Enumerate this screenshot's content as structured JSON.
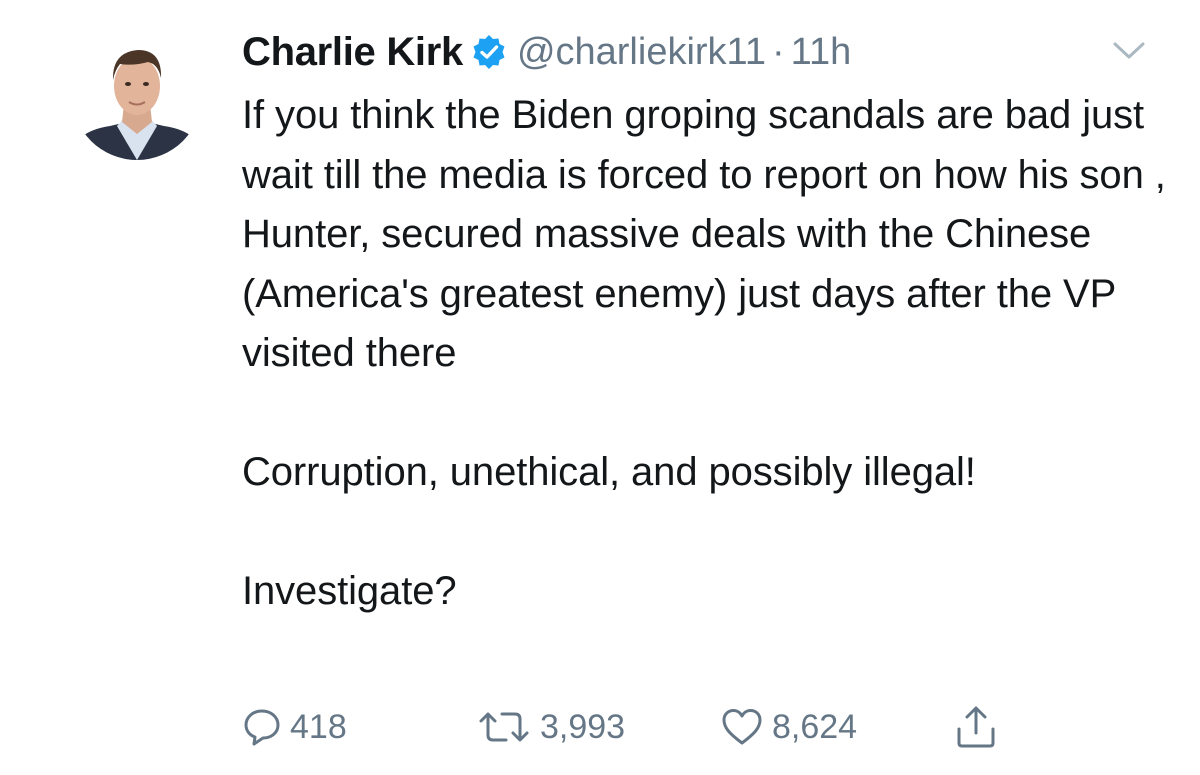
{
  "tweet": {
    "display_name": "Charlie Kirk",
    "handle": "@charliekirk11",
    "separator": "·",
    "time": "11h",
    "text_paragraphs": [
      "If you think the Biden groping scandals are bad just wait till the media is forced to report on how his son , Hunter, secured massive deals with the Chinese (America's greatest enemy) just days after the VP visited there",
      "Corruption, unethical, and possibly illegal!",
      "Investigate?"
    ]
  },
  "actions": {
    "reply_count": "418",
    "retweet_count": "3,993",
    "like_count": "8,624"
  },
  "icons": {
    "verified": "verified-badge-icon",
    "caret": "chevron-down-icon",
    "reply": "reply-icon",
    "retweet": "retweet-icon",
    "like": "heart-icon",
    "share": "share-icon"
  },
  "colors": {
    "text": "#14171a",
    "secondary": "#657786",
    "verified_blue": "#1da1f2"
  }
}
